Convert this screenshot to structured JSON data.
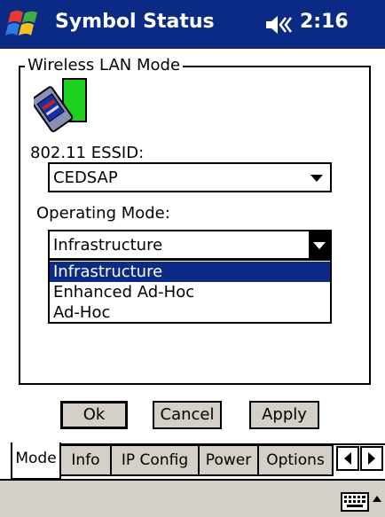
{
  "titlebar": {
    "start_icon": "windows-flag-icon",
    "title": "Symbol Status",
    "volume_icon": "speaker-icon",
    "time": "2:16"
  },
  "wireless": {
    "group_title": "Wireless LAN Mode",
    "card_icon": "wireless-card-icon",
    "essid_label": "802.11 ESSID:",
    "essid_value": "CEDSAP",
    "mode_label": "Operating Mode:",
    "mode_value": "Infrastructure",
    "mode_options": [
      "Infrastructure",
      "Enhanced Ad-Hoc",
      "Ad-Hoc"
    ],
    "mode_selected_index": 0
  },
  "buttons": {
    "ok": "Ok",
    "cancel": "Cancel",
    "apply": "Apply"
  },
  "tabs": {
    "items": [
      "Mode",
      "Info",
      "IP Config",
      "Power",
      "Options"
    ],
    "active": "Mode"
  },
  "bottombar": {
    "keyboard_icon": "keyboard-icon",
    "sip_icon": "up-arrow-icon"
  },
  "colors": {
    "titlebar": "#0b2a85",
    "selection": "#0b2a85",
    "button_face": "#d4d0c8"
  }
}
